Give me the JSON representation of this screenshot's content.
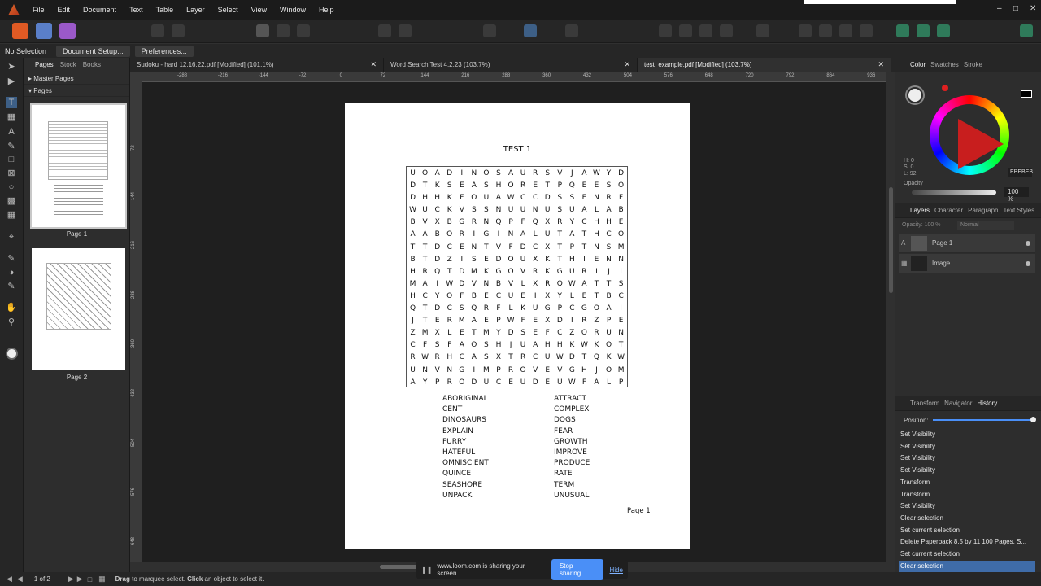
{
  "menubar": {
    "items": [
      "File",
      "Edit",
      "Document",
      "Text",
      "Table",
      "Layer",
      "Select",
      "View",
      "Window",
      "Help"
    ]
  },
  "context": {
    "selection": "No Selection",
    "doc_setup": "Document Setup...",
    "preferences": "Preferences..."
  },
  "pages_panel": {
    "tabs": [
      "Pages",
      "Stock",
      "Books"
    ],
    "master_pages": "Master Pages",
    "pages": "Pages",
    "thumb_labels": [
      "Page 1",
      "Page 2"
    ]
  },
  "doc_tabs": [
    {
      "label": "Sudoku - hard 12.16.22.pdf [Modified] (101.1%)"
    },
    {
      "label": "Word Search Test 4.2.23 (103.7%)"
    },
    {
      "label": "test_example.pdf [Modified] (103.7%)"
    }
  ],
  "ruler_h": [
    "-288",
    "-216",
    "-144",
    "-72",
    "0",
    "72",
    "144",
    "216",
    "288",
    "360",
    "432",
    "504",
    "576",
    "648",
    "720",
    "792",
    "864",
    "936"
  ],
  "ruler_v": [
    "72",
    "144",
    "216",
    "288",
    "360",
    "432",
    "504",
    "576",
    "648",
    "720"
  ],
  "page": {
    "title": "TEST 1",
    "grid": [
      "UOADINOSAURSVJAWYD",
      "DTKSEASHORETPQEESO",
      "DHHKFOUAWCCDSSENRF",
      "WUCKVSSNUUNUSUALAB",
      "BVXBGRNQPFQXRYCHHE",
      "AABORIGINALUTATHCO",
      "TTDCENTVFDCXTPTNSM",
      "BTDZISEDOUXKTHIENN",
      "HRQTDMKGOVRKGURIJI",
      "MAIWDVNBVLXRQWATTS",
      "HCYOFBECUEIXYLETBC",
      "QTDCSQRFLKUGPCGOAI",
      "JTERMAEPWFEXDIRZPE",
      "ZMXLETMYDSEFCZORUN",
      "CFSFAOSHJUAHHKWKOT",
      "RWRHCASXTRCUWDTQKW",
      "UNVNGIMPROVEVGHJOM",
      "AYPRODUCEUDEUWFALP"
    ],
    "words_left": [
      "ABORIGINAL",
      "CENT",
      "DINOSAURS",
      "EXPLAIN",
      "FURRY",
      "HATEFUL",
      "OMNISCIENT",
      "QUINCE",
      "SEASHORE",
      "UNPACK"
    ],
    "words_right": [
      "ATTRACT",
      "COMPLEX",
      "DOGS",
      "FEAR",
      "GROWTH",
      "IMPROVE",
      "PRODUCE",
      "RATE",
      "TERM",
      "UNUSUAL"
    ],
    "page_number": "Page 1"
  },
  "status": {
    "pages": "1 of 2",
    "hint_drag": "Drag",
    "hint_mid": " to marquee select. ",
    "hint_click": "Click",
    "hint_end": " an object to select it."
  },
  "loom": {
    "text": "www.loom.com is sharing your screen.",
    "stop": "Stop sharing",
    "hide": "Hide"
  },
  "color_panel": {
    "tabs": [
      "Color",
      "Swatches",
      "Stroke"
    ],
    "h": "H: 0",
    "s": "S: 0",
    "l": "L: 92",
    "hex": "EBEBEB",
    "opacity_label": "Opacity",
    "opacity_value": "100 %"
  },
  "layers_panel": {
    "tabs": [
      "Layers",
      "Character",
      "Paragraph",
      "Text Styles"
    ],
    "opacity": "Opacity: 100 %",
    "blend": "Normal",
    "rows": [
      "Page 1",
      "Image"
    ]
  },
  "history_panel": {
    "tabs": [
      "Transform",
      "Navigator",
      "History"
    ],
    "position": "Position:",
    "items": [
      "Set Visibility",
      "Set Visibility",
      "Set Visibility",
      "Set Visibility",
      "Transform",
      "Transform",
      "Set Visibility",
      "Clear selection",
      "Set current selection",
      "Delete Paperback 8.5 by 11 100 Pages, S...",
      "Set current selection",
      "Clear selection"
    ]
  },
  "colors": {
    "accent": "#3f6ca8",
    "stop_button": "#4a8ff7"
  }
}
